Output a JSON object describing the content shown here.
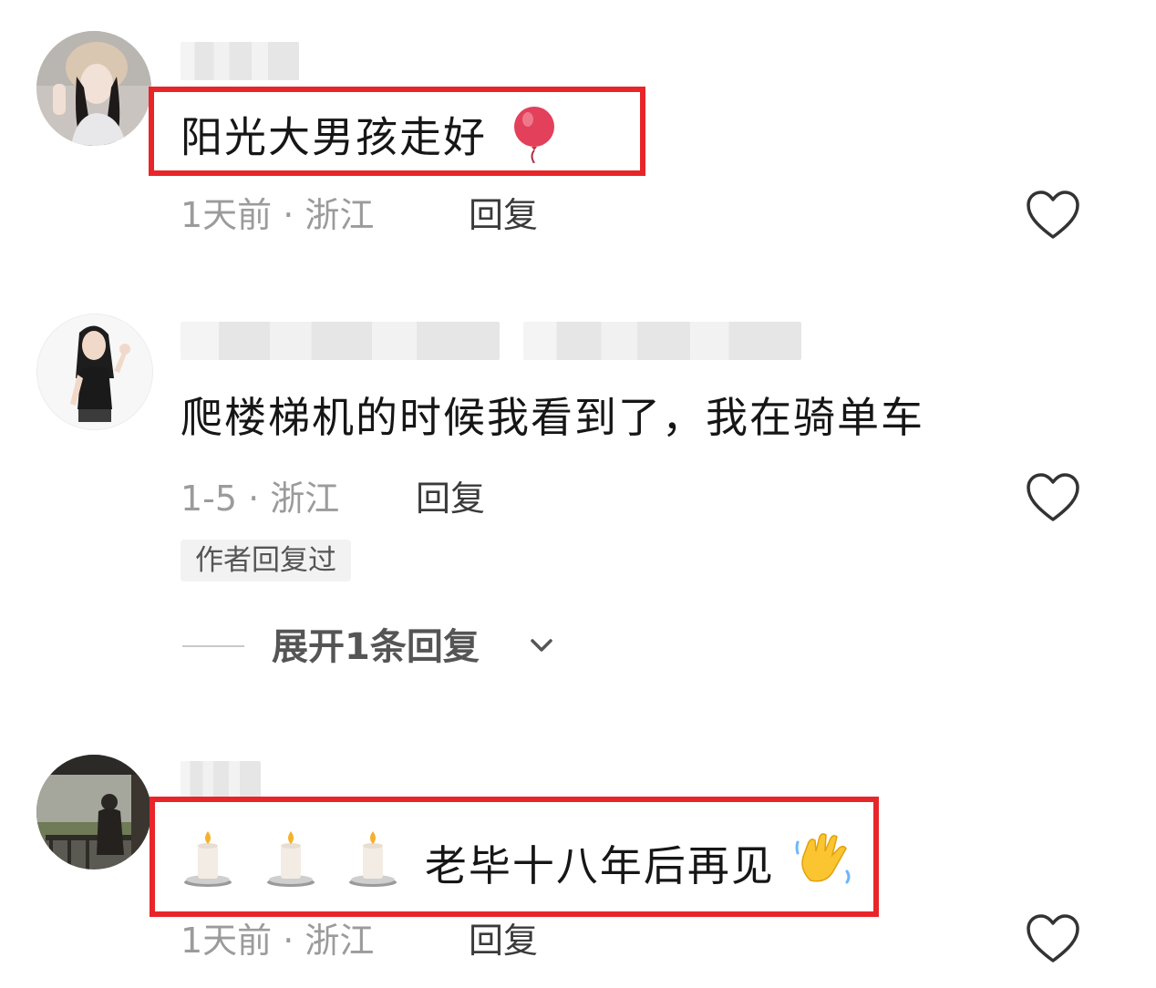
{
  "comments": [
    {
      "text": "阳光大男孩走好",
      "trailing_icon": "balloon-icon",
      "meta": "1天前 · 浙江",
      "reply_label": "回复"
    },
    {
      "text": "爬楼梯机的时候我看到了，我在骑单车",
      "meta": "1-5 · 浙江",
      "reply_label": "回复",
      "author_badge": "作者回复过",
      "expand_label": "展开1条回复"
    },
    {
      "leading_icons": [
        "candle-icon",
        "candle-icon",
        "candle-icon"
      ],
      "text": "老毕十八年后再见",
      "trailing_icon": "waving-hand-icon",
      "meta": "1天前 · 浙江",
      "reply_label": "回复"
    }
  ],
  "colors": {
    "highlight_border": "#e8262a",
    "meta_text": "#9b9b9b",
    "badge_bg": "#f2f2f2"
  }
}
